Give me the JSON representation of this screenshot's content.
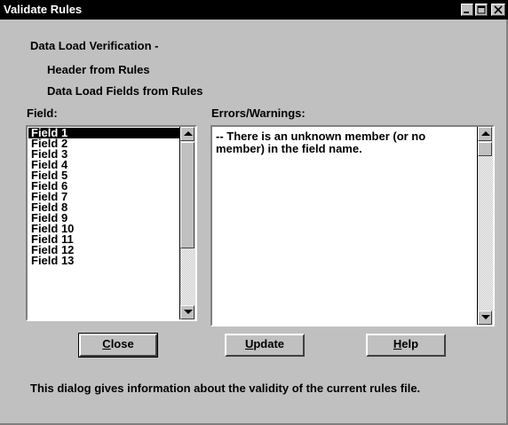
{
  "window": {
    "title": "Validate Rules"
  },
  "header": {
    "line1": "Data Load Verification -",
    "line2": "Header from Rules",
    "line3": "Data Load Fields from Rules"
  },
  "fields": {
    "label": "Field:",
    "items": [
      "Field 1",
      "Field 2",
      "Field 3",
      "Field 4",
      "Field 5",
      "Field 6",
      "Field 7",
      "Field 8",
      "Field 9",
      "Field 10",
      "Field 11",
      "Field 12",
      "Field 13"
    ],
    "selected_index": 0
  },
  "errors": {
    "label": "Errors/Warnings:",
    "line1": "-- There is an unknown member (or no",
    "line2": "member) in the field name."
  },
  "buttons": {
    "close": {
      "accel": "C",
      "rest": "lose"
    },
    "update": {
      "accel": "U",
      "rest": "pdate"
    },
    "help": {
      "accel": "H",
      "rest": "elp"
    }
  },
  "footer": "This dialog gives information about the validity of the current rules file."
}
